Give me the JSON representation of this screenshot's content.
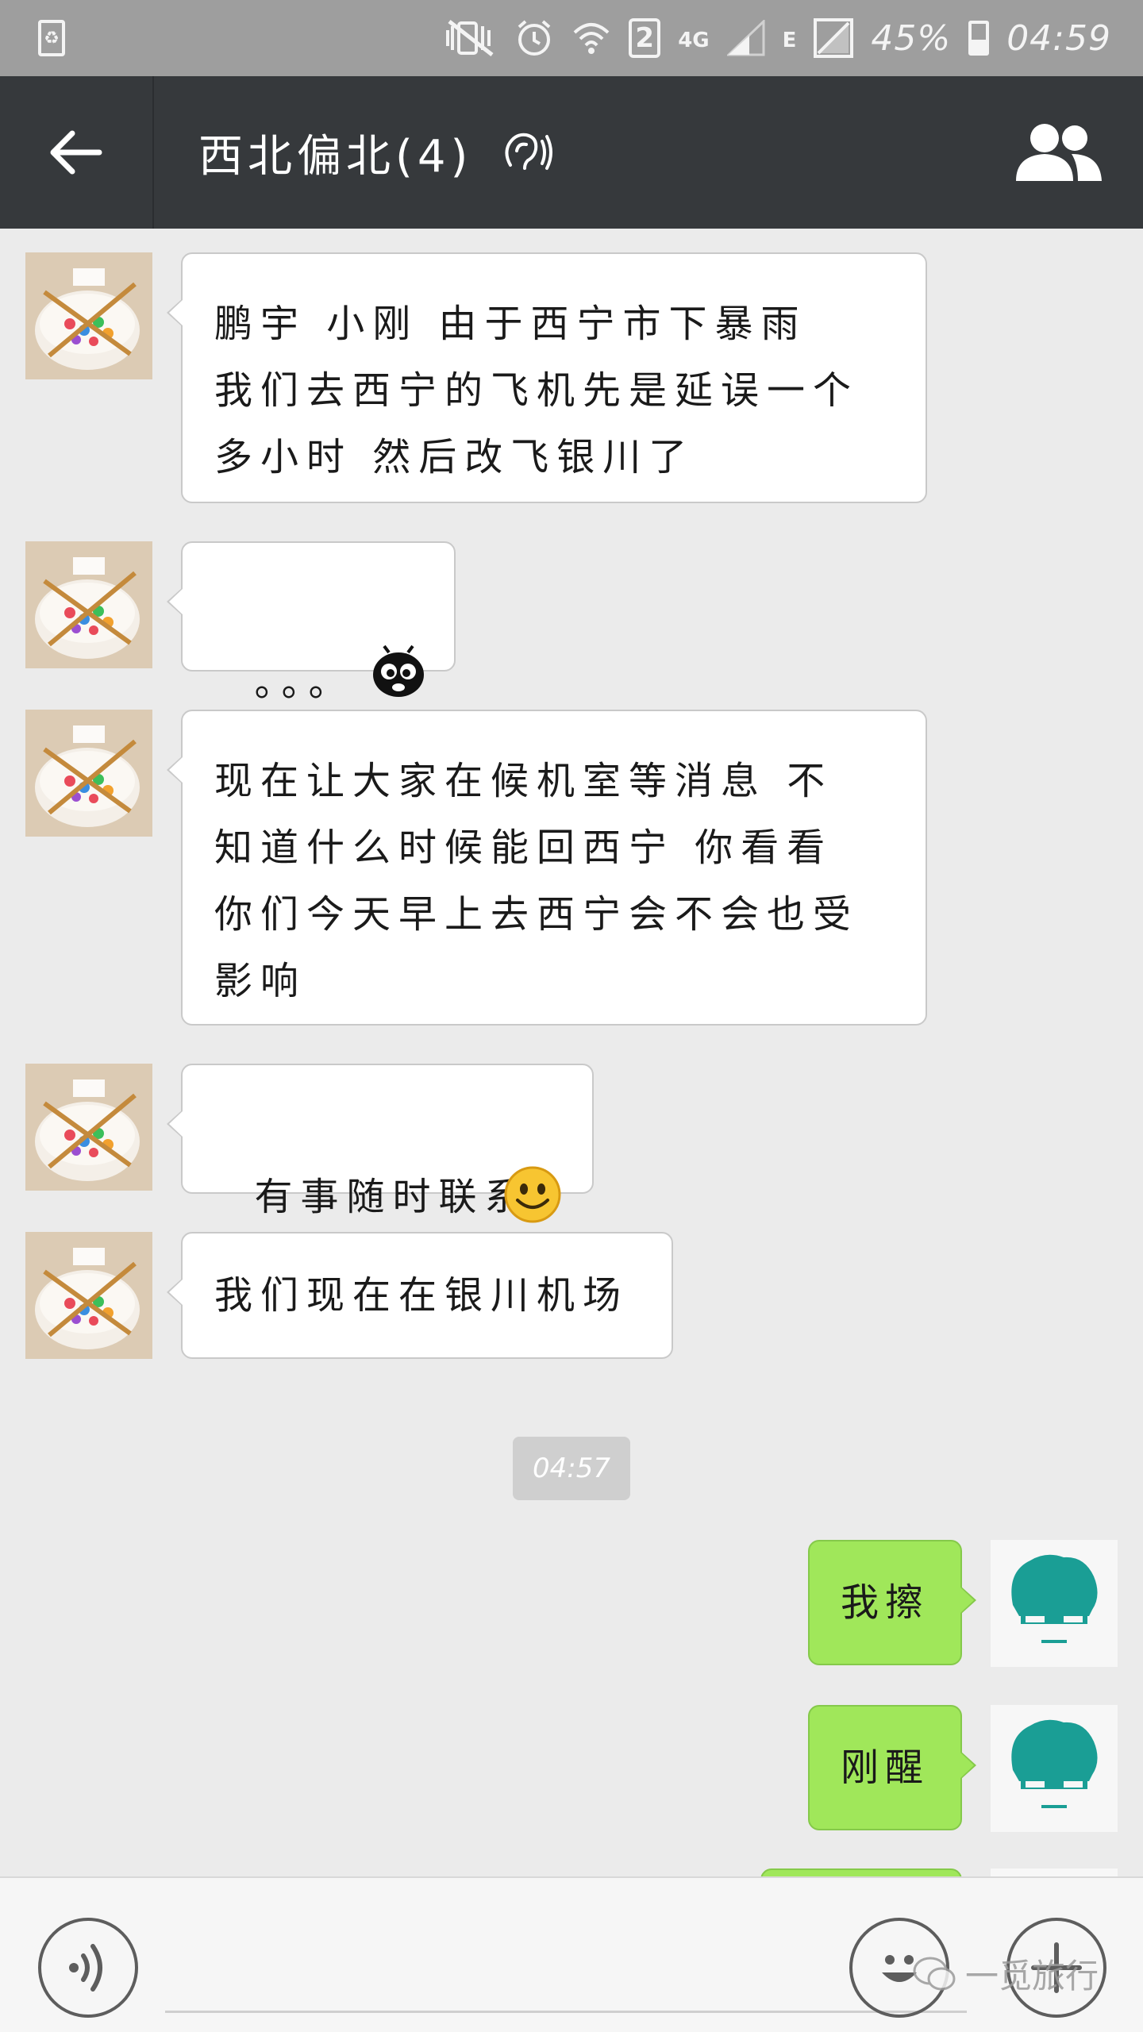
{
  "status_bar": {
    "signal_4g": "4G",
    "signal_e": "E",
    "sim_slot": "2",
    "battery_percent": "45%",
    "battery_level": 0.45,
    "time": "04:59"
  },
  "header": {
    "title": "西北偏北(4)"
  },
  "messages": [
    {
      "direction": "in",
      "text": "鹏宇 小刚 由于西宁市下暴雨\n我们去西宁的飞机先是延误一个\n多小时 然后改飞银川了"
    },
    {
      "direction": "in",
      "text": "。。。",
      "sticker": "bee-face-icon"
    },
    {
      "direction": "in",
      "text": "现在让大家在候机室等消息 不\n知道什么时候能回西宁 你看看\n你们今天早上去西宁会不会也受\n影响"
    },
    {
      "direction": "in",
      "text": "有事随时联系",
      "emoji": "smiley-icon"
    },
    {
      "direction": "in",
      "text": "我们现在在银川机场"
    },
    {
      "direction": "out",
      "text": "我擦"
    },
    {
      "direction": "out",
      "text": "刚醒"
    }
  ],
  "timestamp": "04:57",
  "input_bar": {
    "value": "",
    "watermark": "一觅旅行"
  },
  "colors": {
    "status_bar": "#9e9e9e",
    "title_bar": "#36393c",
    "chat_bg": "#ebebeb",
    "bubble_in": "#ffffff",
    "bubble_out": "#a0e75a",
    "avatar_me": "#1a9e95"
  }
}
